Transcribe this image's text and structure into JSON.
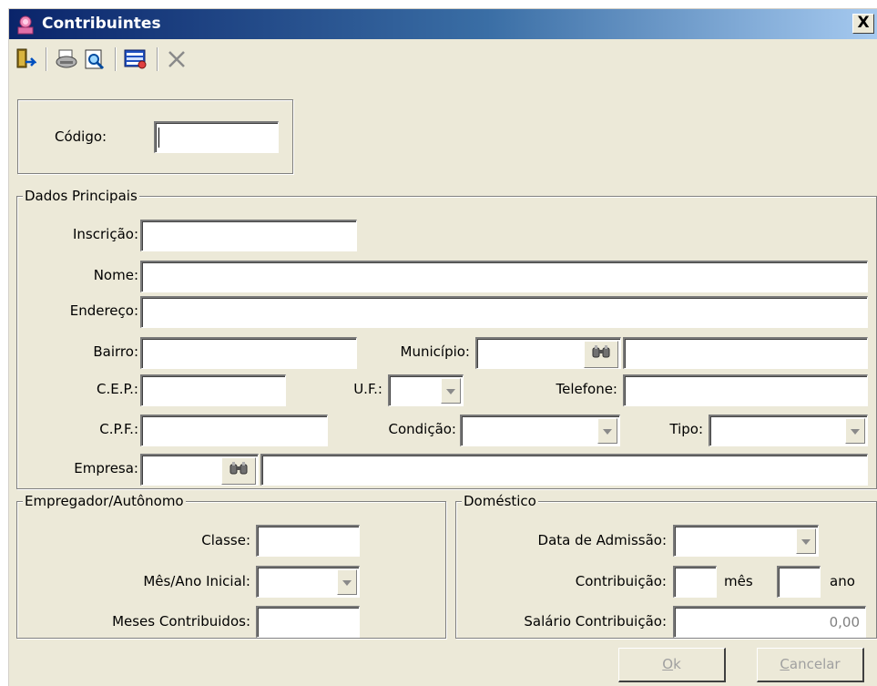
{
  "window": {
    "title": "Contribuintes",
    "close_label": "X"
  },
  "toolbar": {
    "buttons": [
      {
        "name": "exit-icon"
      },
      {
        "name": "print-icon"
      },
      {
        "name": "preview-icon"
      },
      {
        "name": "report-icon"
      },
      {
        "name": "delete-icon"
      }
    ]
  },
  "codigo": {
    "label": "Código:",
    "value": ""
  },
  "dados_principais": {
    "title": "Dados Principais",
    "inscricao_label": "Inscrição:",
    "nome_label": "Nome:",
    "endereco_label": "Endereço:",
    "bairro_label": "Bairro:",
    "municipio_label": "Município:",
    "cep_label": "C.E.P.:",
    "uf_label": "U.F.:",
    "telefone_label": "Telefone:",
    "cpf_label": "C.P.F.:",
    "condicao_label": "Condição:",
    "tipo_label": "Tipo:",
    "empresa_label": "Empresa:"
  },
  "empregador": {
    "title": "Empregador/Autônomo",
    "classe_label": "Classe:",
    "mes_ano_label": "Mês/Ano Inicial:",
    "meses_label": "Meses Contribuidos:"
  },
  "domestico": {
    "title": "Doméstico",
    "admissao_label": "Data de Admissão:",
    "contribuicao_label": "Contribuição:",
    "mes_label": "mês",
    "ano_label": "ano",
    "salario_label": "Salário Contribuição:",
    "salario_value": "0,00"
  },
  "buttons": {
    "ok_accel": "O",
    "ok_rest": "k",
    "cancel_accel": "C",
    "cancel_rest": "ancelar"
  },
  "colors": {
    "window_bg": "#ece9d8",
    "title_start": "#0a246a",
    "title_end": "#a6caf0"
  }
}
